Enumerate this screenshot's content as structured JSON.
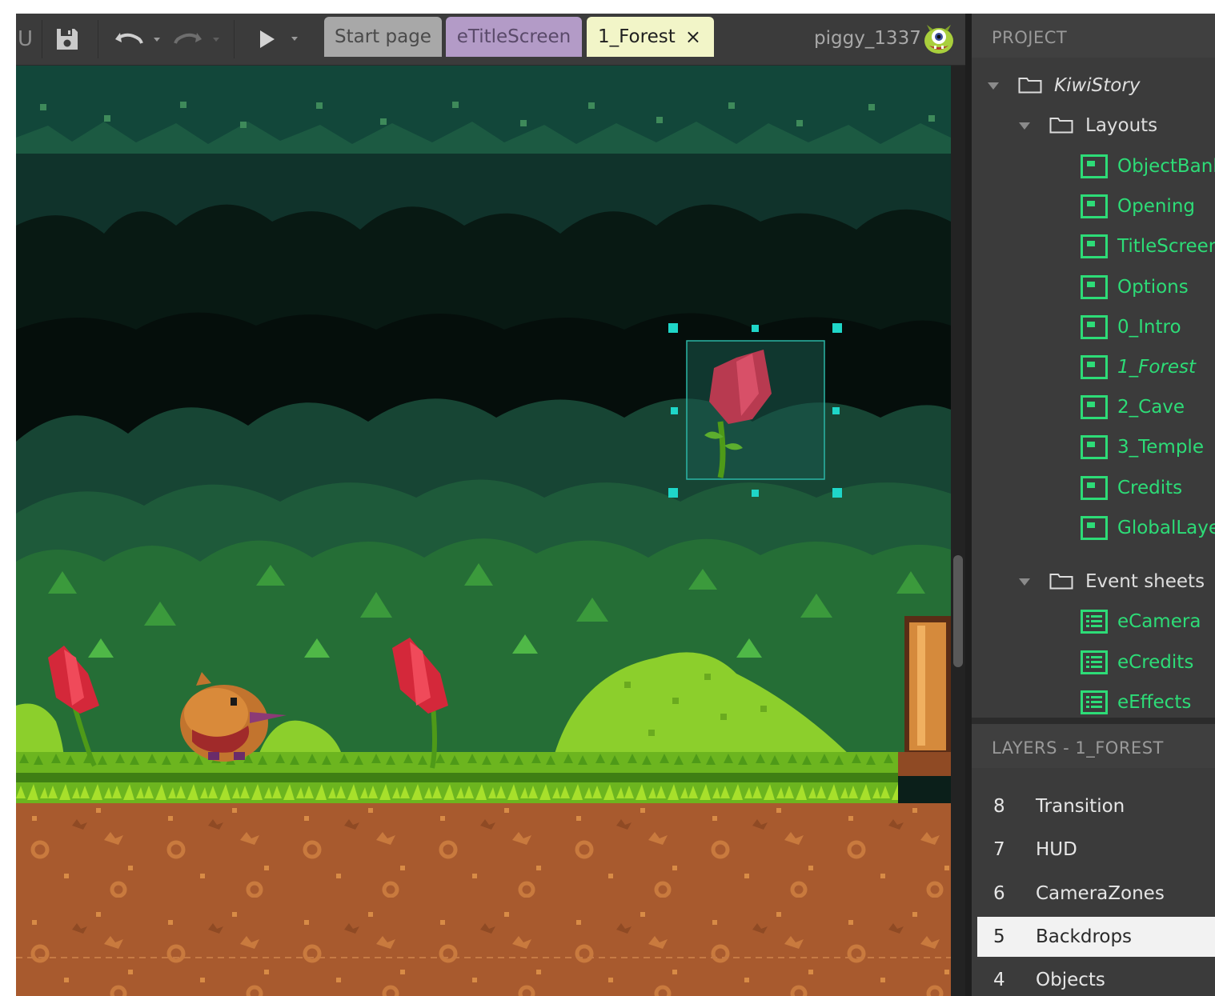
{
  "toolbar": {
    "menu_fragment": "U",
    "save_icon": "save-icon",
    "undo_icon": "undo-icon",
    "redo_icon": "redo-icon",
    "preview_icon": "play-icon",
    "tabs": [
      {
        "label": "Start page",
        "color": "#a8a8a8"
      },
      {
        "label": "eTitleScreen",
        "color": "#b39bc7"
      },
      {
        "label": "1_Forest",
        "close": "×",
        "color": "#f2f5c8",
        "active": true
      }
    ],
    "user": {
      "name": "piggy_1337",
      "avatar": "monster-avatar-icon"
    }
  },
  "project": {
    "header": "PROJECT",
    "root": "KiwiStory",
    "layouts_folder": "Layouts",
    "layouts": [
      "ObjectBank",
      "Opening",
      "TitleScreen",
      "Options",
      "0_Intro",
      "1_Forest",
      "2_Cave",
      "3_Temple",
      "Credits",
      "GlobalLayer"
    ],
    "active_layout": "1_Forest",
    "event_folder": "Event sheets",
    "event_sheets": [
      "eCamera",
      "eCredits",
      "eEffects"
    ]
  },
  "layers": {
    "header": "LAYERS - 1_FOREST",
    "items": [
      {
        "num": "8",
        "name": "Transition"
      },
      {
        "num": "7",
        "name": "HUD"
      },
      {
        "num": "6",
        "name": "CameraZones"
      },
      {
        "num": "5",
        "name": "Backdrops",
        "selected": true
      },
      {
        "num": "4",
        "name": "Objects"
      }
    ]
  },
  "colors": {
    "accent_green": "#2ddc77",
    "selection_handle": "#1fd6c8",
    "panel_bg": "#3b3b3b"
  }
}
